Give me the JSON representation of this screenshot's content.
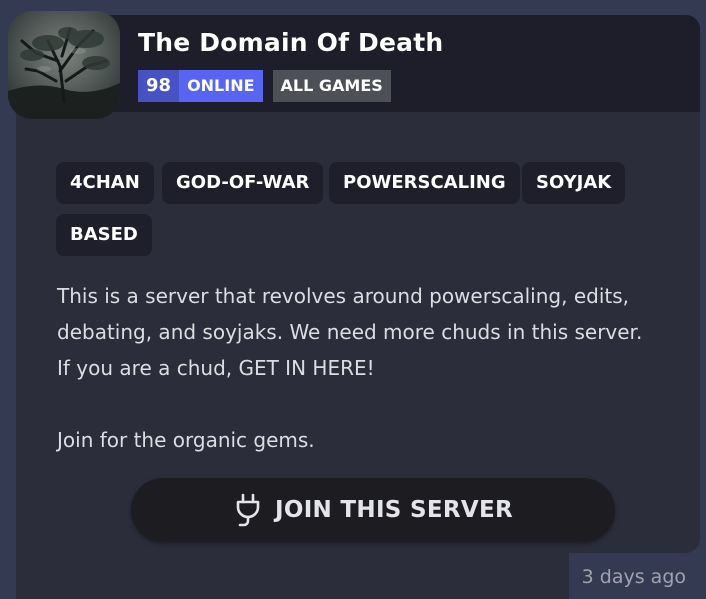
{
  "server": {
    "name": "The Domain Of Death",
    "online_count": "98",
    "online_label": "ONLINE",
    "category_label": "ALL GAMES",
    "icon": "dark-stormy-tree-icon"
  },
  "tags": [
    "4CHAN",
    "GOD-OF-WAR",
    "POWERSCALING",
    "SOYJAK",
    "BASED"
  ],
  "description": {
    "line1": "This is a server that revolves around powerscaling, edits,",
    "line2": "debating, and soyjaks. We need more chuds in this server.",
    "line3": "If you are a chud, GET IN HERE!",
    "line4": "Join for the organic gems."
  },
  "join_button": {
    "label": "JOIN THIS SERVER",
    "icon": "plug-icon"
  },
  "timestamp": "3 days ago",
  "colors": {
    "page_bg": "#353a53",
    "card_bg": "#2b2d3a",
    "header_bg": "#1d1e2a",
    "online_badge": "#5865f2",
    "category_badge": "#4e5058",
    "tag_bg": "#1e1f2b",
    "button_bg": "#1c1c21"
  }
}
